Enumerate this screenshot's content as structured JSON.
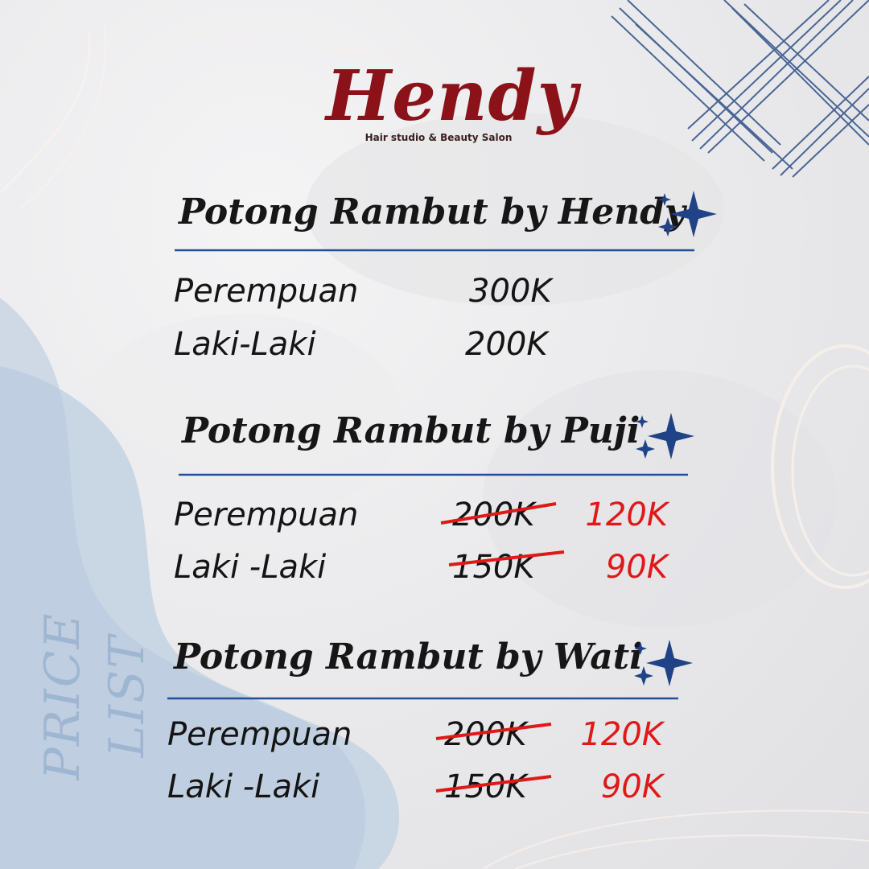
{
  "brand": {
    "name": "Hendy",
    "tagline": "Hair studio & Beauty Salon",
    "color": "#8b1218"
  },
  "colors": {
    "text": "#141414",
    "rule": "#1f4f9a",
    "sale": "#e01818",
    "strike": "#e01818",
    "sparkle": "#1f4386",
    "side_label": "#9fb6d2"
  },
  "sections": [
    {
      "title": "Potong Rambut by Hendy",
      "rows": [
        {
          "label": "Perempuan",
          "price": "300K"
        },
        {
          "label": "Laki-Laki",
          "price": "200K"
        }
      ]
    },
    {
      "title": "Potong Rambut by Puji",
      "rows": [
        {
          "label": "Perempuan",
          "old_price": "200K",
          "new_price": "120K"
        },
        {
          "label": "Laki -Laki",
          "old_price": "150K",
          "new_price": "90K"
        }
      ]
    },
    {
      "title": "Potong Rambut by Wati",
      "rows": [
        {
          "label": "Perempuan",
          "old_price": "200K",
          "new_price": "120K"
        },
        {
          "label": "Laki -Laki",
          "old_price": "150K",
          "new_price": "90K"
        }
      ]
    }
  ],
  "side_label": "PRICE LIST",
  "icons": [
    "sparkle-icon",
    "sparkle-icon",
    "sparkle-icon"
  ]
}
